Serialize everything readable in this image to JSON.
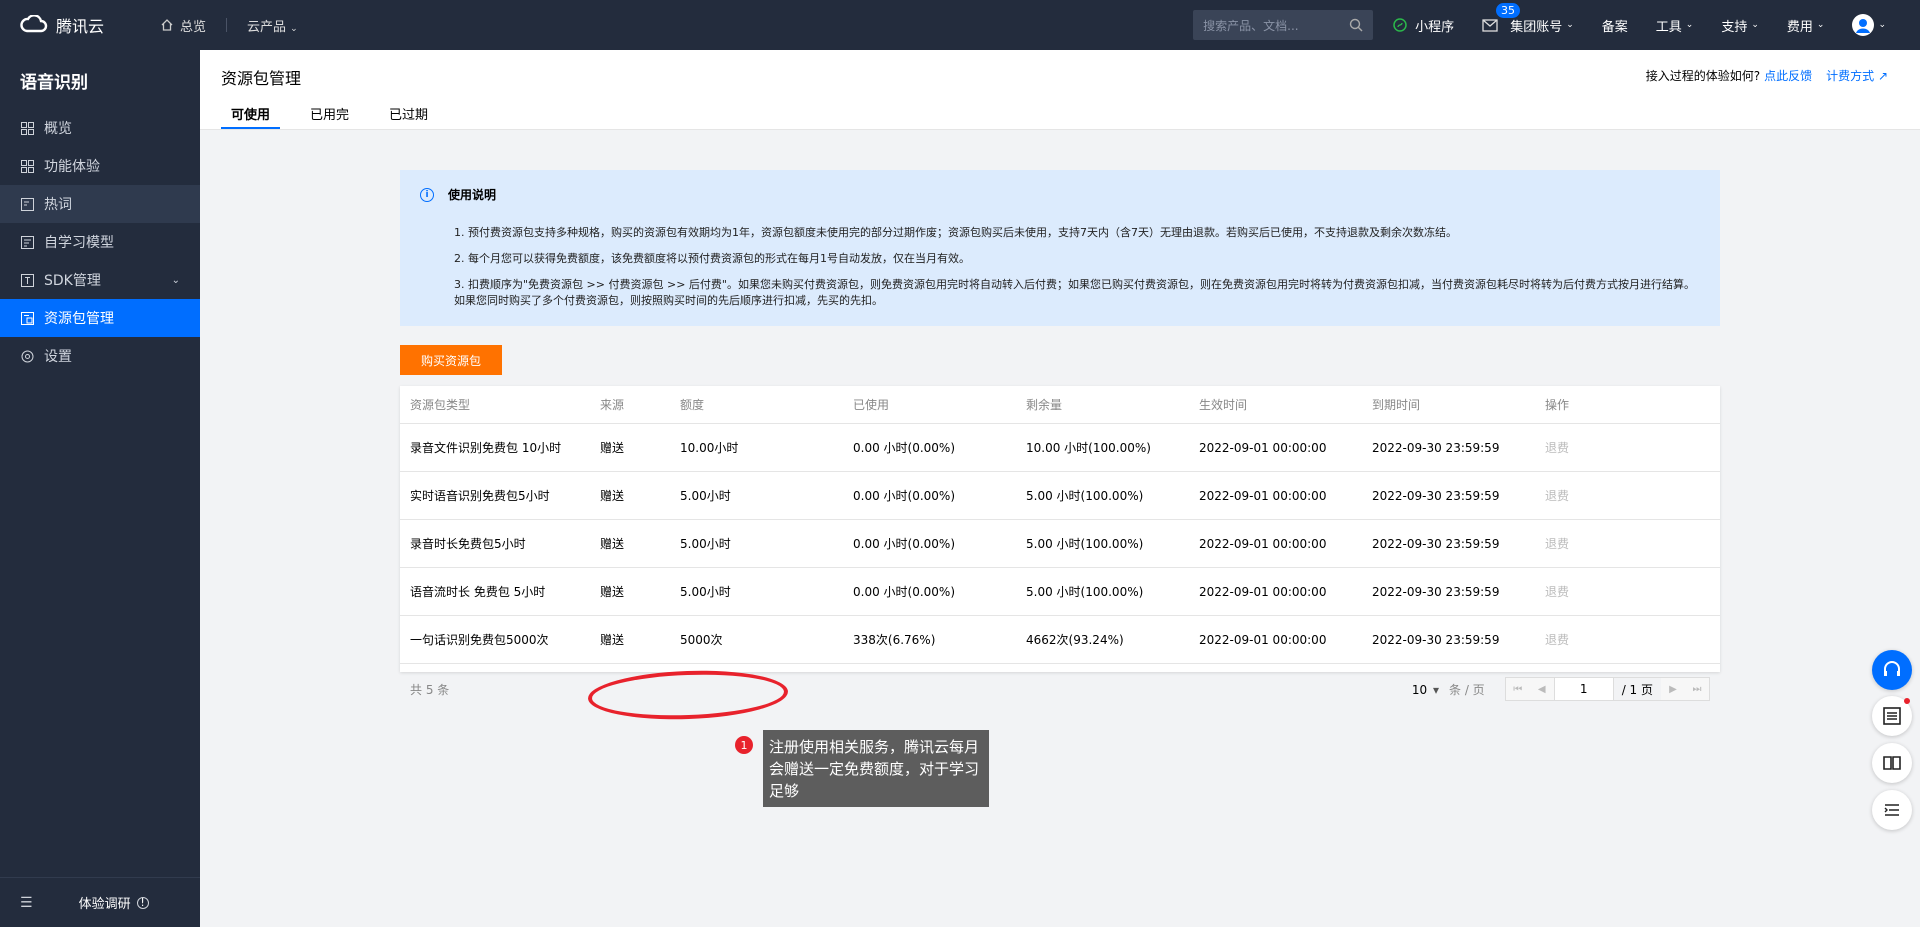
{
  "topbar": {
    "brand": "腾讯云",
    "home": "总览",
    "products": "云产品",
    "search_placeholder": "搜索产品、文档...",
    "mini_program": "小程序",
    "messages_badge": "35",
    "group_account": "集团账号",
    "beian": "备案",
    "tools": "工具",
    "support": "支持",
    "billing": "费用"
  },
  "sidebar": {
    "title": "语音识别",
    "items": [
      {
        "label": "概览"
      },
      {
        "label": "功能体验"
      },
      {
        "label": "热词"
      },
      {
        "label": "自学习模型"
      },
      {
        "label": "SDK管理"
      },
      {
        "label": "资源包管理"
      },
      {
        "label": "设置"
      }
    ],
    "footer": "体验调研"
  },
  "header": {
    "title": "资源包管理",
    "tabs": [
      "可使用",
      "已用完",
      "已过期"
    ],
    "feedback_q": "接入过程的体验如何?",
    "feedback_link": "点此反馈",
    "pricing_link": "计费方式"
  },
  "tip": {
    "title": "使用说明",
    "items": [
      "1. 预付费资源包支持多种规格，购买的资源包有效期均为1年，资源包额度未使用完的部分过期作废；资源包购买后未使用，支持7天内（含7天）无理由退款。若购买后已使用，不支持退款及剩余次数冻结。",
      "2. 每个月您可以获得免费额度，该免费额度将以预付费资源包的形式在每月1号自动发放，仅在当月有效。",
      "3. 扣费顺序为\"免费资源包 >> 付费资源包 >> 后付费\"。如果您未购买付费资源包，则免费资源包用完时将自动转入后付费；如果您已购买付费资源包，则在免费资源包用完时将转为付费资源包扣减，当付费资源包耗尽时将转为后付费方式按月进行结算。如果您同时购买了多个付费资源包，则按照购买时间的先后顺序进行扣减，先买的先扣。"
    ]
  },
  "buy_button": "购买资源包",
  "table": {
    "headers": [
      "资源包类型",
      "来源",
      "额度",
      "已使用",
      "剩余量",
      "生效时间",
      "到期时间",
      "操作"
    ],
    "rows": [
      [
        "录音文件识别免费包 10小时",
        "赠送",
        "10.00小时",
        "0.00 小时(0.00%)",
        "10.00 小时(100.00%)",
        "2022-09-01 00:00:00",
        "2022-09-30 23:59:59",
        "退费"
      ],
      [
        "实时语音识别免费包5小时",
        "赠送",
        "5.00小时",
        "0.00 小时(0.00%)",
        "5.00 小时(100.00%)",
        "2022-09-01 00:00:00",
        "2022-09-30 23:59:59",
        "退费"
      ],
      [
        "录音时长免费包5小时",
        "赠送",
        "5.00小时",
        "0.00 小时(0.00%)",
        "5.00 小时(100.00%)",
        "2022-09-01 00:00:00",
        "2022-09-30 23:59:59",
        "退费"
      ],
      [
        "语音流时长 免费包 5小时",
        "赠送",
        "5.00小时",
        "0.00 小时(0.00%)",
        "5.00 小时(100.00%)",
        "2022-09-01 00:00:00",
        "2022-09-30 23:59:59",
        "退费"
      ],
      [
        "一句话识别免费包5000次",
        "赠送",
        "5000次",
        "338次(6.76%)",
        "4662次(93.24%)",
        "2022-09-01 00:00:00",
        "2022-09-30 23:59:59",
        "退费"
      ]
    ],
    "total": "共 5 条",
    "page_size": "10",
    "page_size_unit": "条 / 页",
    "current_page": "1",
    "total_pages": "/ 1 页"
  },
  "annotation": {
    "number": "1",
    "text": "注册使用相关服务，腾讯云每月会赠送一定免费额度，对于学习足够"
  }
}
